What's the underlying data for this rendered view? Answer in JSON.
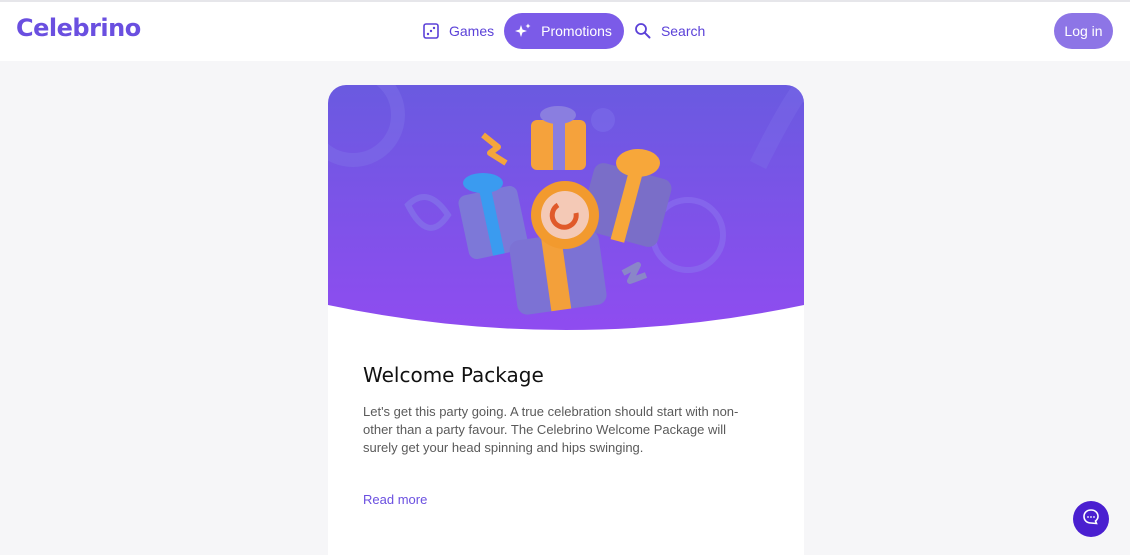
{
  "brand": {
    "logo_text": "Celebrino",
    "accent_color": "#7b5be8"
  },
  "nav": {
    "items": [
      {
        "label": "Games",
        "icon": "dice-icon",
        "active": false
      },
      {
        "label": "Promotions",
        "icon": "sparkle-icon",
        "active": true
      },
      {
        "label": "Search",
        "icon": "search-icon",
        "active": false
      }
    ]
  },
  "header": {
    "login_label": "Log in"
  },
  "promo": {
    "title": "Welcome Package",
    "description": "Let's get this party going. A true celebration should start with non-other than a party favour. The Celebrino Welcome Package will surely get your head spinning and hips swinging.",
    "read_more": "Read more",
    "hero_icon": "gift-boxes-illustration"
  },
  "chat": {
    "icon": "chat-bubble-icon"
  }
}
